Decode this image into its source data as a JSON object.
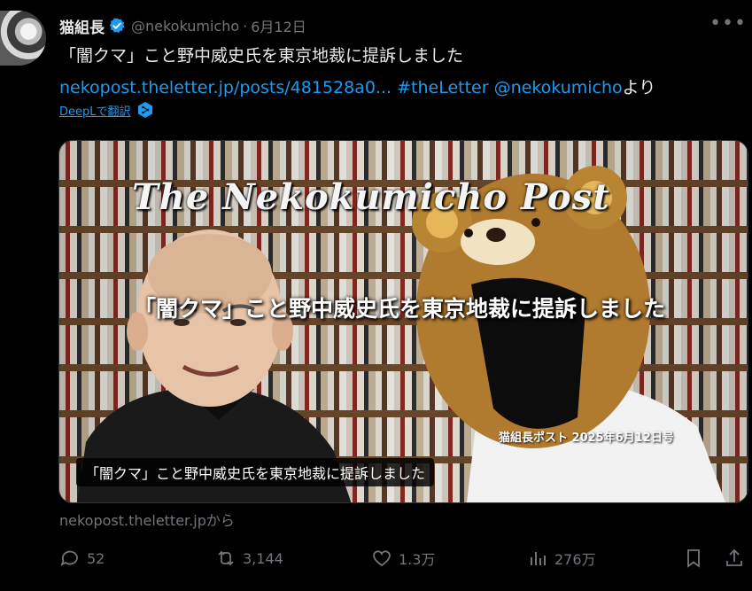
{
  "author": {
    "name": "猫組長",
    "handle": "@nekokumicho",
    "separator": "·",
    "date": "6月12日"
  },
  "post": {
    "line1": "「闇クマ」こと野中威史氏を東京地裁に提訴しました",
    "link_url": "nekopost.theletter.jp/posts/481528a0...",
    "hashtag": "#theLetter",
    "mention": "@nekokumicho",
    "suffix": "より",
    "translate_label": "DeepLで翻訳"
  },
  "media": {
    "video_title": "The Nekokumicho Post",
    "overlay_caption": "「闇クマ」こと野中威史氏を東京地裁に提訴しました",
    "stamp": "猫組長ポスト 2025年6月12日号",
    "subtitle": "「闇クマ」こと野中威史氏を東京地裁に提訴しました"
  },
  "source_label": "nekopost.theletter.jpから",
  "actions": {
    "replies": "52",
    "reposts": "3,144",
    "likes": "1.3万",
    "views": "276万"
  },
  "colors": {
    "background": "#000000",
    "text": "#e7e9ea",
    "muted": "#71767b",
    "link": "#1d9bf0",
    "verified": "#1d9bf0"
  },
  "icons": [
    "verified-icon",
    "more-icon",
    "deepl-icon",
    "reply-icon",
    "repost-icon",
    "like-icon",
    "views-icon",
    "bookmark-icon",
    "share-icon"
  ]
}
